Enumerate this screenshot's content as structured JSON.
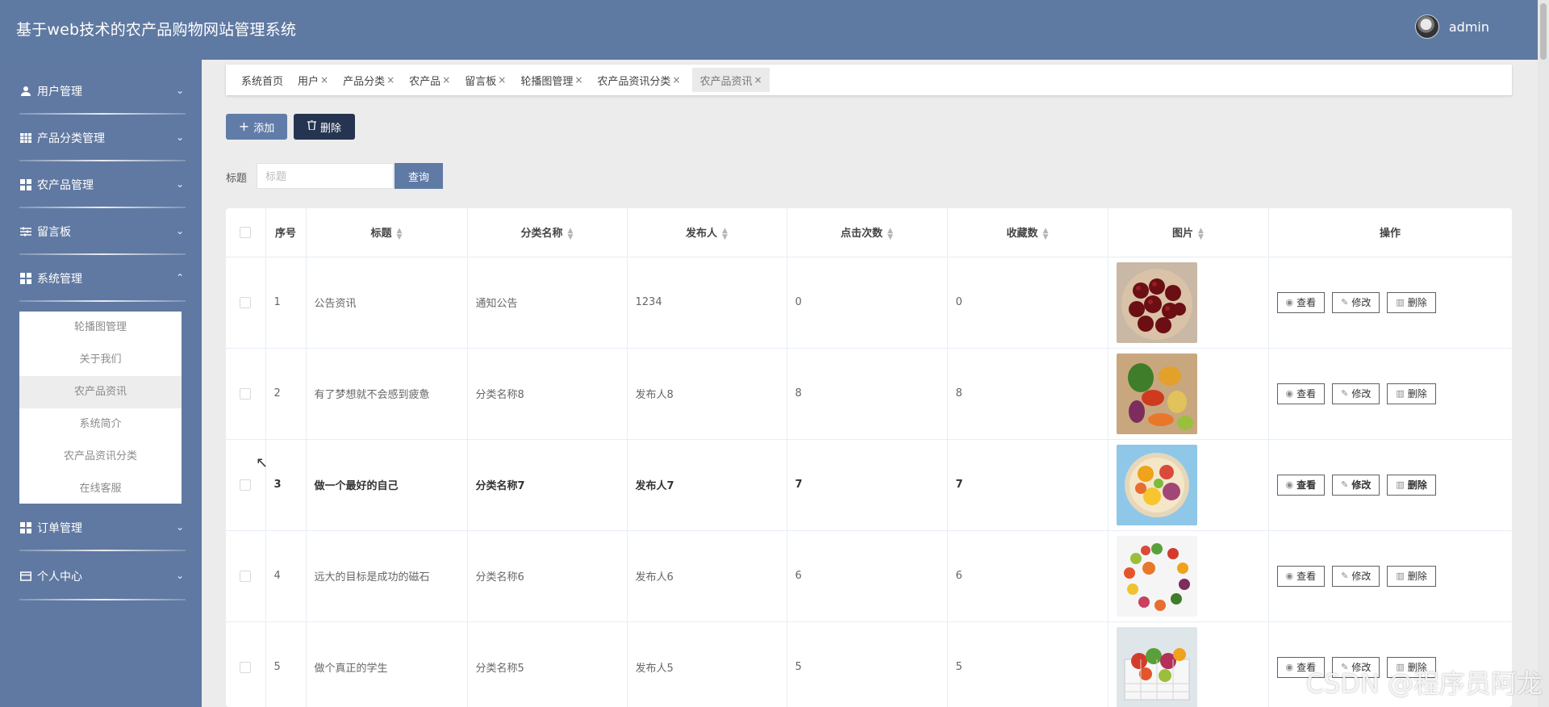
{
  "header": {
    "title": "基于web技术的农产品购物网站管理系统",
    "username": "admin"
  },
  "sidebar": {
    "items": [
      {
        "label": "用户管理",
        "icon": "user-icon",
        "chevron": "⌄"
      },
      {
        "label": "产品分类管理",
        "icon": "table-icon",
        "chevron": "⌄"
      },
      {
        "label": "农产品管理",
        "icon": "grid-icon",
        "chevron": "⌄"
      },
      {
        "label": "留言板",
        "icon": "sliders-icon",
        "chevron": "⌄"
      },
      {
        "label": "系统管理",
        "icon": "grid-icon",
        "chevron": "⌃"
      },
      {
        "label": "订单管理",
        "icon": "grid-icon",
        "chevron": "⌄"
      },
      {
        "label": "个人中心",
        "icon": "card-icon",
        "chevron": "⌄"
      }
    ],
    "submenu": [
      "轮播图管理",
      "关于我们",
      "农产品资讯",
      "系统简介",
      "农产品资讯分类",
      "在线客服"
    ]
  },
  "tabs": [
    {
      "label": "系统首页",
      "close": ""
    },
    {
      "label": "用户",
      "close": "×"
    },
    {
      "label": "产品分类",
      "close": "×"
    },
    {
      "label": "农产品",
      "close": "×"
    },
    {
      "label": "留言板",
      "close": "×"
    },
    {
      "label": "轮播图管理",
      "close": "×"
    },
    {
      "label": "农产品资讯分类",
      "close": "×"
    },
    {
      "label": "农产品资讯",
      "close": "×"
    }
  ],
  "actions": {
    "add": "添加",
    "delete": "删除"
  },
  "search": {
    "label": "标题",
    "placeholder": "标题",
    "button": "查询"
  },
  "table": {
    "headers": [
      "序号",
      "标题",
      "分类名称",
      "发布人",
      "点击次数",
      "收藏数",
      "图片",
      "操作"
    ],
    "rows": [
      {
        "index": "1",
        "title": "公告资讯",
        "category": "通知公告",
        "publisher": "1234",
        "clicks": "0",
        "favorites": "0",
        "image": "cherries"
      },
      {
        "index": "2",
        "title": "有了梦想就不会感到疲惫",
        "category": "分类名称8",
        "publisher": "发布人8",
        "clicks": "8",
        "favorites": "8",
        "image": "vegetables"
      },
      {
        "index": "3",
        "title": "做一个最好的自己",
        "category": "分类名称7",
        "publisher": "发布人7",
        "clicks": "7",
        "favorites": "7",
        "image": "fruit-plate"
      },
      {
        "index": "4",
        "title": "远大的目标是成功的磁石",
        "category": "分类名称6",
        "publisher": "发布人6",
        "clicks": "6",
        "favorites": "6",
        "image": "vegetable-circle"
      },
      {
        "index": "5",
        "title": "做个真正的学生",
        "category": "分类名称5",
        "publisher": "发布人5",
        "clicks": "5",
        "favorites": "5",
        "image": "produce-basket"
      }
    ],
    "ops": {
      "view": "查看",
      "edit": "修改",
      "delete": "删除"
    }
  },
  "watermark": "CSDN @程序员阿龙"
}
